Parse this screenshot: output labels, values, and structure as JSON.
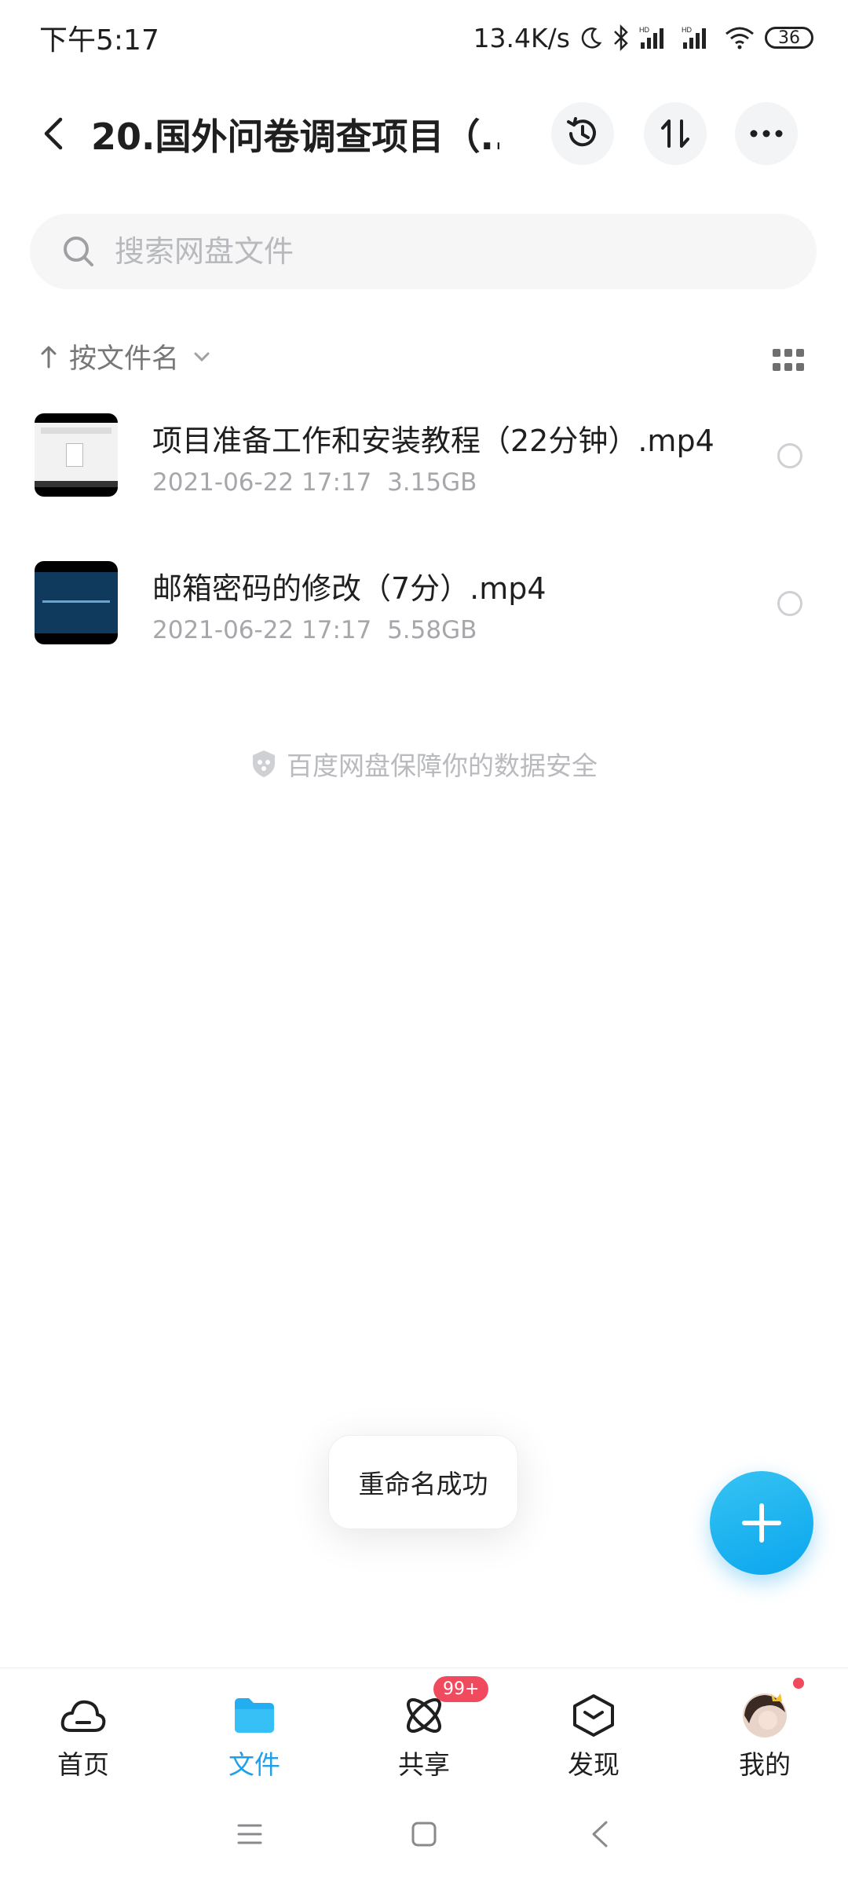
{
  "status_bar": {
    "time": "下午5:17",
    "net_speed": "13.4K/s",
    "battery": "36"
  },
  "header": {
    "title": "20.国外问卷调查项目（...",
    "back_icon": "chevron-left-icon",
    "history_icon": "history-icon",
    "transfer_icon": "transfer-icon",
    "more_icon": "more-icon"
  },
  "search": {
    "placeholder": "搜索网盘文件"
  },
  "sort": {
    "label": "按文件名"
  },
  "files": [
    {
      "name": "项目准备工作和安装教程（22分钟）.mp4",
      "date": "2021-06-22  17:17",
      "size": "3.15GB"
    },
    {
      "name": "邮箱密码的修改（7分）.mp4",
      "date": "2021-06-22  17:17",
      "size": "5.58GB"
    }
  ],
  "security_note": "百度网盘保障你的数据安全",
  "toast": "重命名成功",
  "bottom_nav": {
    "items": [
      {
        "label": "首页",
        "icon": "cloud-home-icon"
      },
      {
        "label": "文件",
        "icon": "folder-icon"
      },
      {
        "label": "共享",
        "icon": "share-orbit-icon"
      },
      {
        "label": "发现",
        "icon": "discover-cube-icon"
      },
      {
        "label": "我的",
        "icon": "avatar-icon"
      }
    ],
    "active_index": 1,
    "share_badge": "99+"
  },
  "colors": {
    "accent": "#1ea0ea",
    "fab": "#17aef0",
    "badge": "#f04a5e"
  }
}
